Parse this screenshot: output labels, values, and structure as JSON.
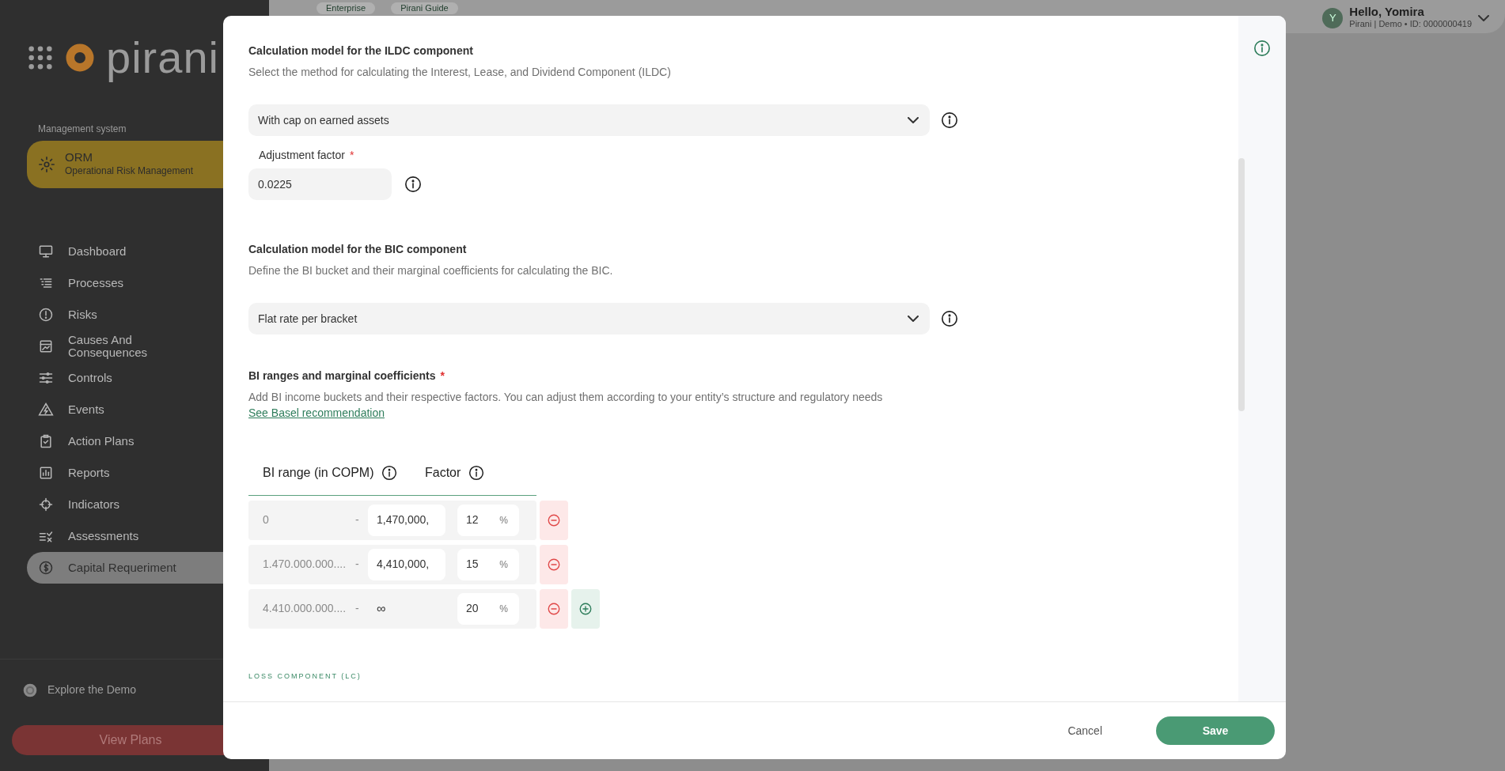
{
  "sidebar": {
    "logo": "pirani",
    "section_label": "Management system",
    "system": {
      "name": "ORM",
      "description": "Operational Risk Management"
    },
    "items": [
      {
        "label": "Dashboard",
        "selected": false
      },
      {
        "label": "Processes",
        "selected": false
      },
      {
        "label": "Risks",
        "selected": false
      },
      {
        "label": "Causes And Consequences",
        "selected": false
      },
      {
        "label": "Controls",
        "selected": false
      },
      {
        "label": "Events",
        "selected": false
      },
      {
        "label": "Action Plans",
        "selected": false
      },
      {
        "label": "Reports",
        "selected": false
      },
      {
        "label": "Indicators",
        "selected": false
      },
      {
        "label": "Assessments",
        "selected": false
      },
      {
        "label": "Capital Requeriment",
        "selected": true
      }
    ],
    "explore": "Explore the Demo",
    "plans_button": "View Plans"
  },
  "header": {
    "tabs": [
      "Enterprise",
      "Pirani Guide"
    ],
    "user": {
      "avatar": "Y",
      "greeting": "Hello, Yomira",
      "subtitle": "Pirani | Demo • ID: 0000000419"
    }
  },
  "modal": {
    "ildc": {
      "title": "Calculation model for the ILDC component",
      "description": "Select the method for calculating the Interest, Lease, and Dividend Component (ILDC)",
      "select": "With cap on earned assets",
      "field_label": "Adjustment factor",
      "required_mark": "*",
      "field_value": "0.0225"
    },
    "bic": {
      "title": "Calculation model for the BIC component",
      "description": "Define the BI bucket and their marginal coefficients for calculating the BIC.",
      "select": "Flat rate per bracket"
    },
    "ranges": {
      "title": "BI ranges and marginal coefficients",
      "required_mark": "*",
      "description": "Add BI income buckets and their respective factors. You can adjust them according to your entity’s structure and regulatory needs",
      "link": "See Basel recommendation",
      "columns": [
        "BI range (in COPM)",
        "Factor"
      ],
      "rows": [
        {
          "from": "0",
          "separator": "-",
          "to": "1,470,000,",
          "to_editable": true,
          "factor": "12",
          "unit": "%",
          "can_add": false
        },
        {
          "from": "1.470.000.000....",
          "separator": "-",
          "to": "4,410,000,",
          "to_editable": true,
          "factor": "15",
          "unit": "%",
          "can_add": false
        },
        {
          "from": "4.410.000.000....",
          "separator": "-",
          "to": "∞",
          "to_editable": false,
          "factor": "20",
          "unit": "%",
          "can_add": true
        }
      ]
    },
    "next_section": "LOSS COMPONENT (LC)",
    "cancel": "Cancel",
    "save": "Save"
  }
}
